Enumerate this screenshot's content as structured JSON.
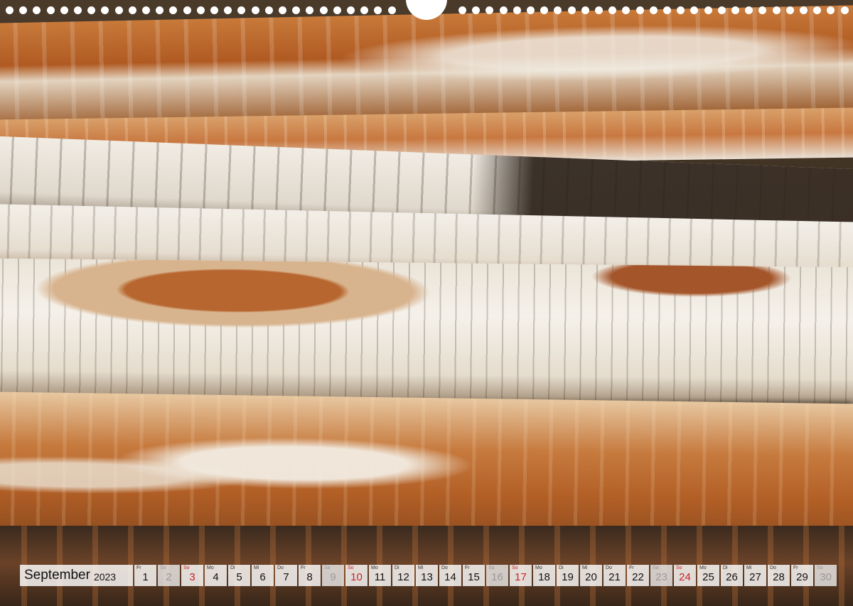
{
  "calendar": {
    "month": "September",
    "year": "2023",
    "days": [
      {
        "wd": "Fr",
        "n": "1",
        "type": "weekday"
      },
      {
        "wd": "Sa",
        "n": "2",
        "type": "sat"
      },
      {
        "wd": "So",
        "n": "3",
        "type": "sun"
      },
      {
        "wd": "Mo",
        "n": "4",
        "type": "weekday"
      },
      {
        "wd": "Di",
        "n": "5",
        "type": "weekday"
      },
      {
        "wd": "Mi",
        "n": "6",
        "type": "weekday"
      },
      {
        "wd": "Do",
        "n": "7",
        "type": "weekday"
      },
      {
        "wd": "Fr",
        "n": "8",
        "type": "weekday"
      },
      {
        "wd": "Sa",
        "n": "9",
        "type": "sat"
      },
      {
        "wd": "So",
        "n": "10",
        "type": "sun"
      },
      {
        "wd": "Mo",
        "n": "11",
        "type": "weekday"
      },
      {
        "wd": "Di",
        "n": "12",
        "type": "weekday"
      },
      {
        "wd": "Mi",
        "n": "13",
        "type": "weekday"
      },
      {
        "wd": "Do",
        "n": "14",
        "type": "weekday"
      },
      {
        "wd": "Fr",
        "n": "15",
        "type": "weekday"
      },
      {
        "wd": "Sa",
        "n": "16",
        "type": "sat"
      },
      {
        "wd": "So",
        "n": "17",
        "type": "sun"
      },
      {
        "wd": "Mo",
        "n": "18",
        "type": "weekday"
      },
      {
        "wd": "Di",
        "n": "19",
        "type": "weekday"
      },
      {
        "wd": "Mi",
        "n": "20",
        "type": "weekday"
      },
      {
        "wd": "Do",
        "n": "21",
        "type": "weekday"
      },
      {
        "wd": "Fr",
        "n": "22",
        "type": "weekday"
      },
      {
        "wd": "Sa",
        "n": "23",
        "type": "sat"
      },
      {
        "wd": "So",
        "n": "24",
        "type": "sun"
      },
      {
        "wd": "Mo",
        "n": "25",
        "type": "weekday"
      },
      {
        "wd": "Di",
        "n": "26",
        "type": "weekday"
      },
      {
        "wd": "Mi",
        "n": "27",
        "type": "weekday"
      },
      {
        "wd": "Do",
        "n": "28",
        "type": "weekday"
      },
      {
        "wd": "Fr",
        "n": "29",
        "type": "weekday"
      },
      {
        "wd": "Sa",
        "n": "30",
        "type": "sat"
      }
    ]
  },
  "colors": {
    "sunday": "#c8242a",
    "saturday": "#9a9a9a",
    "binding_holes": "#ffffff"
  },
  "photo": {
    "subject_icon": "birch-logs-photo"
  }
}
